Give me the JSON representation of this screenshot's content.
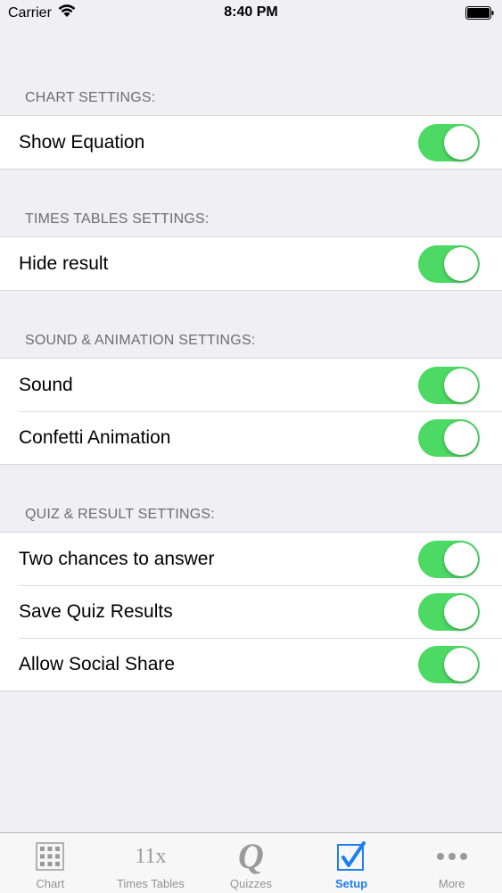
{
  "status_bar": {
    "carrier": "Carrier",
    "time": "8:40 PM"
  },
  "sections": [
    {
      "header": "CHART SETTINGS:",
      "rows": [
        {
          "label": "Show Equation",
          "on": true
        }
      ]
    },
    {
      "header": "TIMES TABLES SETTINGS:",
      "rows": [
        {
          "label": "Hide result",
          "on": true
        }
      ]
    },
    {
      "header": "SOUND & ANIMATION SETTINGS:",
      "rows": [
        {
          "label": "Sound",
          "on": true
        },
        {
          "label": "Confetti Animation",
          "on": true
        }
      ]
    },
    {
      "header": "QUIZ & RESULT SETTINGS:",
      "rows": [
        {
          "label": "Two chances to answer",
          "on": true
        },
        {
          "label": "Save Quiz Results",
          "on": true
        },
        {
          "label": "Allow Social Share",
          "on": true
        }
      ]
    }
  ],
  "tab_bar": {
    "tabs": [
      {
        "label": "Chart",
        "icon": "grid-icon",
        "active": false
      },
      {
        "label": "Times Tables",
        "icon_text": "11x",
        "icon": "times-tables-icon",
        "active": false
      },
      {
        "label": "Quizzes",
        "icon_text": "Q",
        "icon": "quiz-icon",
        "active": false
      },
      {
        "label": "Setup",
        "icon": "checkbox-icon",
        "active": true
      },
      {
        "label": "More",
        "icon": "more-dots-icon",
        "active": false
      }
    ]
  },
  "colors": {
    "toggle_on": "#4cd964",
    "tab_active": "#1d7ef2",
    "tab_inactive": "#929292",
    "background": "#efeff4"
  }
}
